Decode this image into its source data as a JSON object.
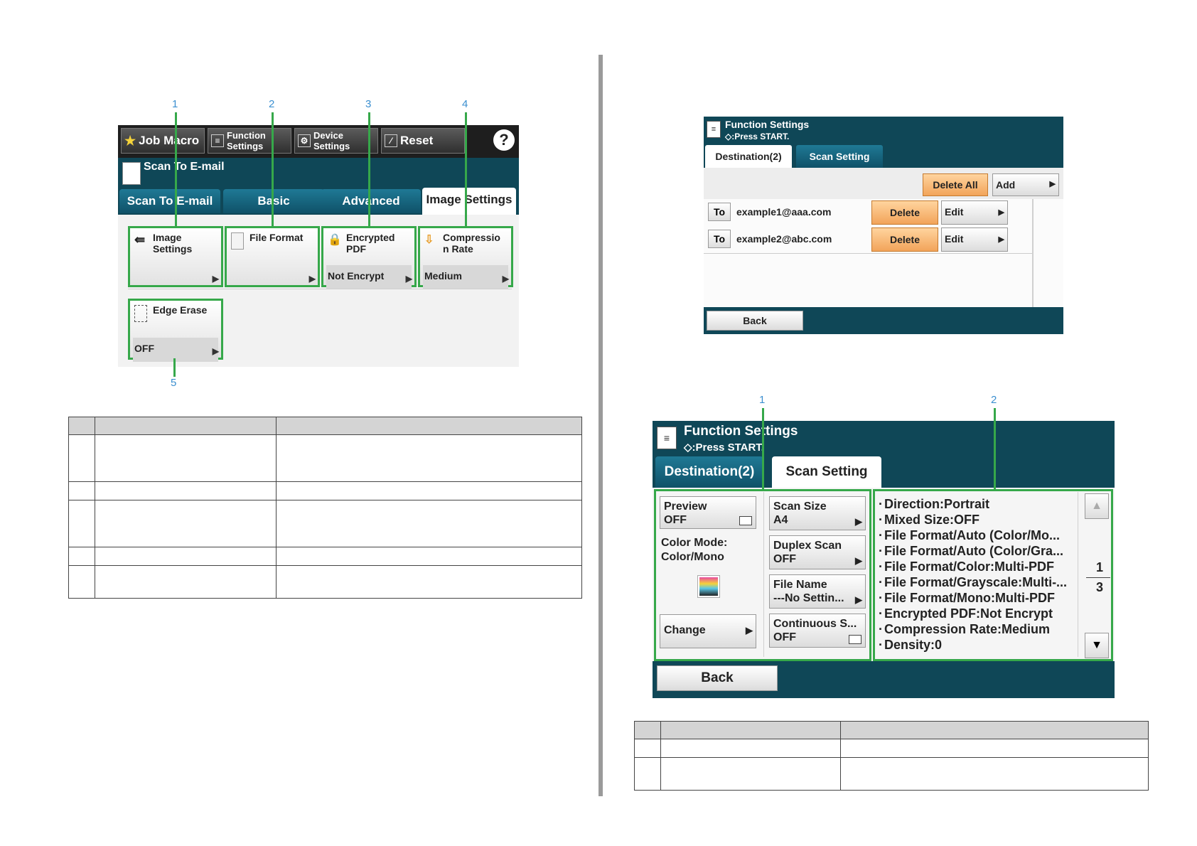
{
  "screen1": {
    "topbar": {
      "job_macro": "Job Macro",
      "function_settings_line1": "Function",
      "function_settings_line2": "Settings",
      "device_settings_line1": "Device",
      "device_settings_line2": "Settings",
      "reset": "Reset",
      "help": "?"
    },
    "title": "Scan To E-mail",
    "tabs": [
      "Scan To E-mail",
      "Basic",
      "Advanced",
      "Image Settings"
    ],
    "active_tab": "Image Settings",
    "buttons": [
      {
        "label1": "Image",
        "label2": "Settings",
        "value": ""
      },
      {
        "label1": "File Format",
        "label2": "",
        "value": ""
      },
      {
        "label1": "Encrypted",
        "label2": "PDF",
        "value": "Not Encrypt"
      },
      {
        "label1": "Compressio",
        "label2": "n Rate",
        "value": "Medium"
      }
    ],
    "edge_erase": {
      "label": "Edge Erase",
      "value": "OFF"
    },
    "callouts": [
      "1",
      "2",
      "3",
      "4",
      "5"
    ]
  },
  "screen2": {
    "title": "Function Settings",
    "subtitle": "◇:Press START.",
    "tabs": [
      "Destination(2)",
      "Scan Setting"
    ],
    "delete_all": "Delete All",
    "add": "Add",
    "rows": [
      {
        "to": "To",
        "address": "example1@aaa.com",
        "delete": "Delete",
        "edit": "Edit"
      },
      {
        "to": "To",
        "address": "example2@abc.com",
        "delete": "Delete",
        "edit": "Edit"
      }
    ],
    "back": "Back"
  },
  "screen3": {
    "title": "Function Settings",
    "subtitle": "◇:Press START.",
    "tabs": [
      "Destination(2)",
      "Scan Setting"
    ],
    "preview": {
      "label": "Preview",
      "value": "OFF"
    },
    "color_mode_label": "Color Mode:",
    "color_mode_value": "Color/Mono",
    "change": "Change",
    "settings": [
      {
        "label": "Scan Size",
        "value": "A4"
      },
      {
        "label": "Duplex Scan",
        "value": "OFF"
      },
      {
        "label": "File Name",
        "value": "---No Settin..."
      },
      {
        "label": "Continuous S...",
        "value": "OFF"
      }
    ],
    "summary": [
      "Direction:Portrait",
      "Mixed Size:OFF",
      "File Format/Auto (Color/Mo...",
      "File Format/Auto (Color/Gra...",
      "File Format/Color:Multi-PDF",
      "File Format/Grayscale:Multi-...",
      "File Format/Mono:Multi-PDF",
      "Encrypted PDF:Not Encrypt",
      "Compression Rate:Medium",
      "Density:0"
    ],
    "page_current": "1",
    "page_total": "3",
    "back": "Back",
    "callouts": [
      "1",
      "2"
    ]
  }
}
